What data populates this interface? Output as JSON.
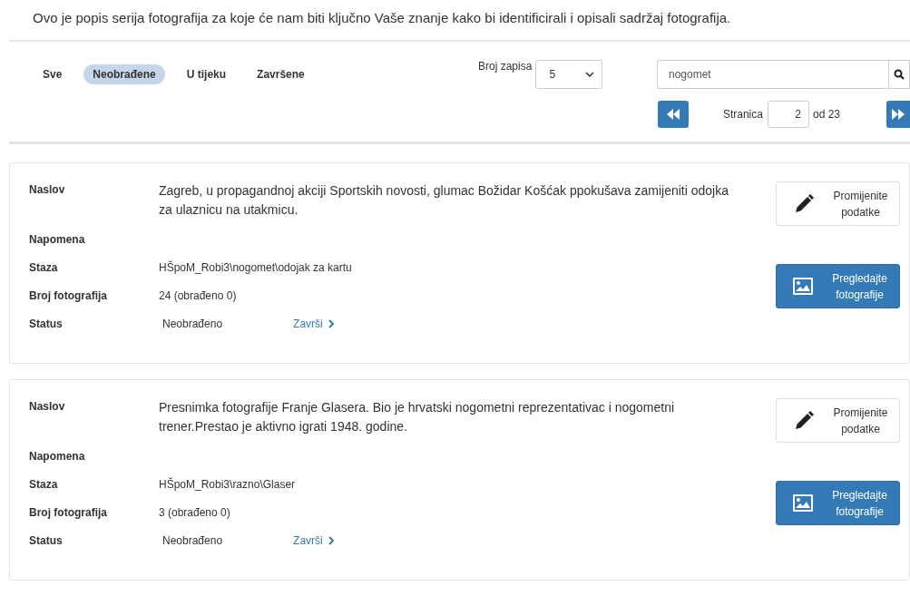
{
  "intro": "Ovo je popis serija fotografija za koje će nam biti ključno Vaše znanje kako bi identificirali i opisali sadržaj fotografija.",
  "filters": [
    {
      "label": "Sve",
      "selected": false
    },
    {
      "label": "Neobrađene",
      "selected": true
    },
    {
      "label": "U tijeku",
      "selected": false
    },
    {
      "label": "Završene",
      "selected": false
    }
  ],
  "page_size": {
    "label": "Broj zapisa",
    "value": "5"
  },
  "search": {
    "value": "nogomet"
  },
  "pager": {
    "label": "Stranica",
    "page": "2",
    "total": "od 23"
  },
  "series": [
    {
      "fields": [
        {
          "label": "Naslov",
          "value": "Zagreb, u propagandnoj akciji Sportskih novosti, glumac Božidar Košćak ppokušava zamijeniti odojka za ulaznicu na utakmicu.",
          "kind": "title"
        },
        {
          "label": "Napomena",
          "kind": "text"
        },
        {
          "label": "Staza",
          "value": "HŠpoM_Robi3\\nogomet\\odojak za kartu",
          "kind": "text"
        },
        {
          "label": "Broj fotografija",
          "value": "24 (obrađeno 0)",
          "kind": "text"
        },
        {
          "label": "Status",
          "value": "Neobrađeno",
          "kind": "status",
          "link": "Završi"
        }
      ],
      "edit_button": "Promijenite podatke",
      "view_button": "Pregledajte fotografije"
    },
    {
      "fields": [
        {
          "label": "Naslov",
          "value": "Presnimka fotografije Franje Glasera. Bio je hrvatski nogometni reprezentativac i nogometni trener.Prestao je aktivno igrati 1948. godine.",
          "kind": "title"
        },
        {
          "label": "Napomena",
          "kind": "text"
        },
        {
          "label": "Staza",
          "value": "HŠpoM_Robi3\\razno\\Glaser",
          "kind": "text"
        },
        {
          "label": "Broj fotografija",
          "value": "3 (obrađeno 0)",
          "kind": "text"
        },
        {
          "label": "Status",
          "value": "Neobrađeno",
          "kind": "status",
          "link": "Završi"
        }
      ],
      "edit_button": "Promijenite podatke",
      "view_button": "Pregledajte fotografije"
    }
  ]
}
